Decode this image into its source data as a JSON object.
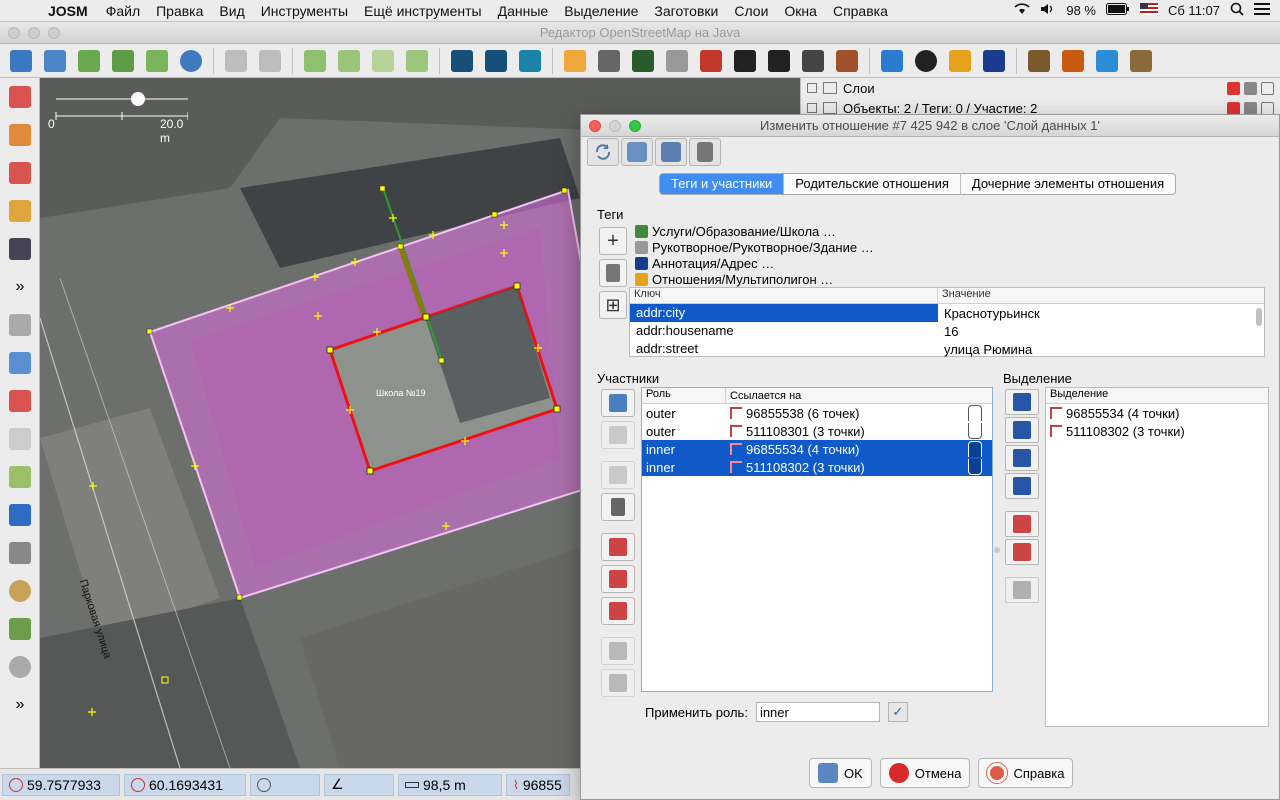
{
  "menubar": {
    "app": "JOSM",
    "menus": [
      "Файл",
      "Правка",
      "Вид",
      "Инструменты",
      "Ещё инструменты",
      "Данные",
      "Выделение",
      "Заготовки",
      "Слои",
      "Окна",
      "Справка"
    ],
    "battery": "98 %",
    "clock": "Сб 11:07"
  },
  "window": {
    "title": "Редактор OpenStreetMap на Java"
  },
  "map": {
    "scale_zero": "0",
    "scale_label": "20.0 m",
    "building_label": "Школа №19",
    "street_label": "Парковая улица"
  },
  "layers_panel": {
    "title": "Слои",
    "objects_info": "Объекты: 2 / Теги: 0 / Участие: 2"
  },
  "status": {
    "lat": "59.7577933",
    "lon": "60.1693431",
    "distance": "98,5 m",
    "id": "96855"
  },
  "dialog": {
    "title": "Изменить отношение #7 425 942 в слое 'Слой данных 1'",
    "tabs": [
      "Теги и участники",
      "Родительские отношения",
      "Дочерние элементы отношения"
    ],
    "tags_label": "Теги",
    "presets": [
      "Услуги/Образование/Школа …",
      "Рукотворное/Рукотворное/Здание …",
      "Аннотация/Адрес …",
      "Отношения/Мультиполигон …"
    ],
    "tag_table": {
      "key_header": "Ключ",
      "value_header": "Значение",
      "rows": [
        {
          "key": "addr:city",
          "value": "Краснотурьинск"
        },
        {
          "key": "addr:housename",
          "value": "16"
        },
        {
          "key": "addr:street",
          "value": "улица Рюмина"
        }
      ]
    },
    "members_label": "Участники",
    "members_table": {
      "role_header": "Роль",
      "ref_header": "Ссылается на",
      "rows": [
        {
          "role": "outer",
          "ref": "96855538 (6 точек)"
        },
        {
          "role": "outer",
          "ref": "511108301 (3 точки)"
        },
        {
          "role": "inner",
          "ref": "96855534 (4 точки)"
        },
        {
          "role": "inner",
          "ref": "511108302 (3 точки)"
        }
      ]
    },
    "selection_label": "Выделение",
    "selection_table": {
      "header": "Выделение",
      "rows": [
        "96855534 (4 точки)",
        "511108302 (3 точки)"
      ]
    },
    "apply_role_label": "Применить роль:",
    "apply_role_value": "inner",
    "buttons": {
      "ok": "OK",
      "cancel": "Отмена",
      "help": "Справка"
    }
  }
}
